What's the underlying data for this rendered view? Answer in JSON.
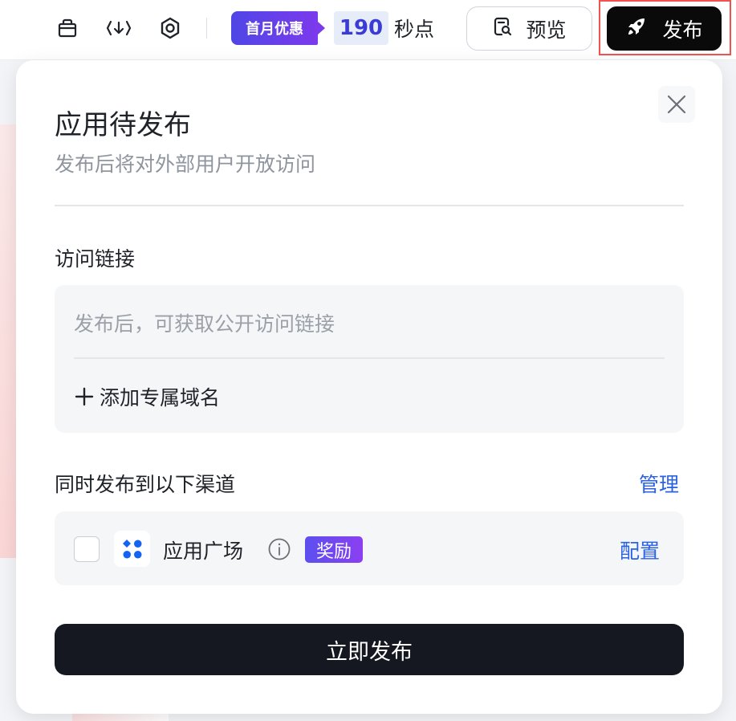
{
  "toolbar": {
    "icons": [
      "shop-bag-icon",
      "code-download-icon",
      "settings-hex-icon"
    ],
    "promo_label": "首月优惠",
    "credits_value": "190",
    "credits_unit": "秒点",
    "preview_label": "预览",
    "publish_label": "发布"
  },
  "modal": {
    "title": "应用待发布",
    "subtitle": "发布后将对外部用户开放访问",
    "link_section": {
      "label": "访问链接",
      "placeholder": "发布后，可获取公开访问链接",
      "add_domain_label": "添加专属域名"
    },
    "channels_section": {
      "label": "同时发布到以下渠道",
      "manage_label": "管理",
      "items": [
        {
          "name": "应用广场",
          "badge": "奖励",
          "config_label": "配置",
          "checked": false
        }
      ]
    },
    "submit_label": "立即发布"
  },
  "colors": {
    "accent_blue": "#2a62e6",
    "promo_gradient_start": "#4f46e5",
    "promo_gradient_end": "#7c3aed",
    "publish_button": "#0a0a0a",
    "highlight_border": "#ef5350",
    "submit_button": "#151820"
  }
}
